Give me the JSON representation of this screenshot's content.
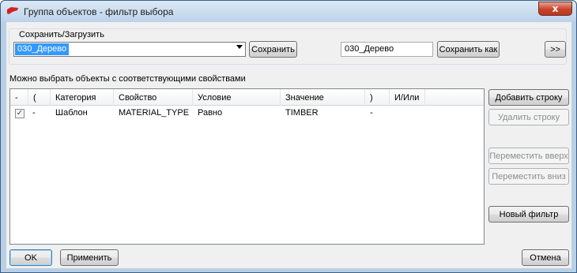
{
  "window": {
    "title": "Группа объектов - фильтр выбора",
    "close_glyph": "x",
    "app_icon": "red-flag-icon"
  },
  "save_load": {
    "group_label": "Сохранить/Загрузить",
    "selected_filter": "030_Дерево",
    "save_button": "Сохранить",
    "save_as_name": "030_Дерево",
    "save_as_button": "Сохранить как",
    "expand_button": ">>"
  },
  "hint_text": "Можно выбрать объекты с соответствующими свойствами",
  "table": {
    "columns": [
      "-",
      "(",
      "Категория",
      "Свойство",
      "Условие",
      "Значение",
      ")",
      "И/Или"
    ],
    "rows": [
      {
        "checked": true,
        "check_glyph": "✓",
        "dash": "-",
        "open_paren": "",
        "category": "Шаблон",
        "property": "MATERIAL_TYPE",
        "condition": "Равно",
        "value": "TIMBER",
        "close_paren": "-",
        "and_or": ""
      }
    ]
  },
  "side_buttons": {
    "add_row": "Добавить строку",
    "delete_row": "Удалить строку",
    "move_up": "Переместить вверх",
    "move_down": "Переместить вниз",
    "new_filter": "Новый фильтр"
  },
  "bottom_buttons": {
    "ok": "OK",
    "apply": "Применить",
    "cancel": "Отмена"
  },
  "colors": {
    "selection": "#3399ff",
    "frame": "#b9cfe6",
    "close_button": "#c7432a",
    "checkmark": "#2d4f93"
  }
}
